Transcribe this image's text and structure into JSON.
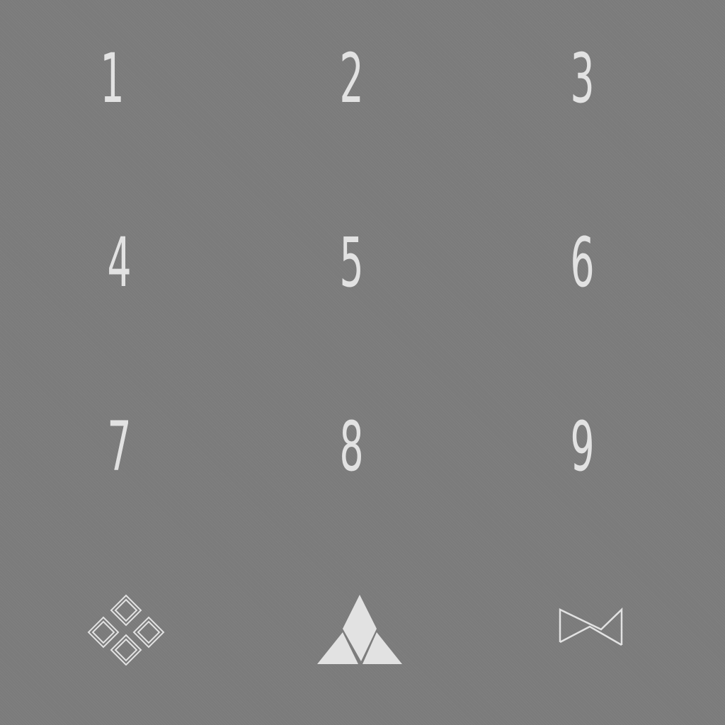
{
  "keypad": {
    "keys": [
      {
        "label": "1"
      },
      {
        "label": "2"
      },
      {
        "label": "3"
      },
      {
        "label": "4"
      },
      {
        "label": "5"
      },
      {
        "label": "6"
      },
      {
        "label": "7"
      },
      {
        "label": "8"
      },
      {
        "label": "9"
      }
    ],
    "bottom_row": {
      "left_icon": "four-diamonds-icon",
      "center_icon": "triangle-icon",
      "right_icon": "bowtie-icon"
    }
  },
  "colors": {
    "background": "#7b7b7b",
    "glyph": "#e2e2e2"
  }
}
